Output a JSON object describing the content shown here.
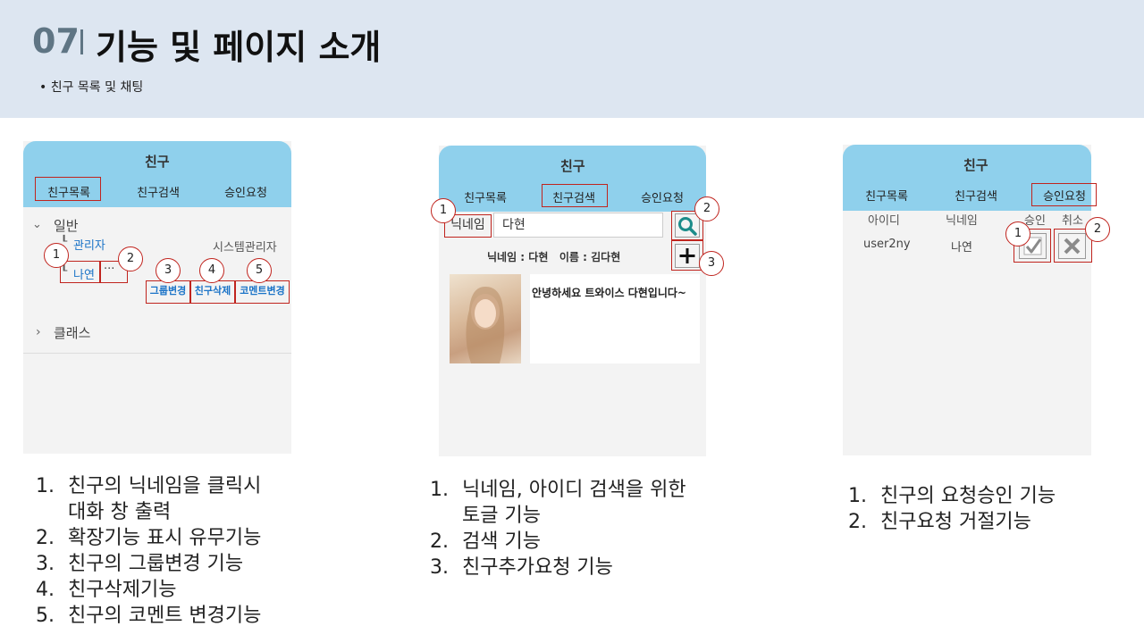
{
  "header": {
    "number": "07",
    "title": "기능 및 페이지 소개",
    "subtitle": "• 친구 목록 및 채팅"
  },
  "panel1": {
    "title": "친구",
    "tabs": [
      "친구목록",
      "친구검색",
      "승인요청"
    ],
    "group_general": "일반",
    "friend1": "관리자",
    "friend1_comment": "시스템관리자",
    "friend2": "나연",
    "more": "···",
    "btn_group": "그룹변경",
    "btn_delete": "친구삭제",
    "btn_comment": "코멘트변경",
    "group_class": "클래스",
    "markers": [
      "1",
      "2",
      "3",
      "4",
      "5"
    ]
  },
  "panel2": {
    "title": "친구",
    "tabs": [
      "친구목록",
      "친구검색",
      "승인요청"
    ],
    "search_type": "닉네임",
    "search_value": "다현",
    "result": "닉네임 : 다현   이름 : 김다현",
    "profile_text": "안녕하세요 트와이스 다현입니다~",
    "markers": [
      "1",
      "2",
      "3"
    ]
  },
  "panel3": {
    "title": "친구",
    "tabs": [
      "친구목록",
      "친구검색",
      "승인요청"
    ],
    "columns": [
      "아이디",
      "닉네임",
      "승인",
      "취소"
    ],
    "row": {
      "id": "user2ny",
      "nickname": "나연"
    },
    "markers": [
      "1",
      "2"
    ]
  },
  "descriptions": {
    "col1": [
      {
        "n": "1.",
        "t": "친구의 닉네임을 클릭시"
      },
      {
        "n": "",
        "t": "대화 창 출력"
      },
      {
        "n": "2.",
        "t": "확장기능 표시 유무기능"
      },
      {
        "n": "3.",
        "t": "친구의 그룹변경 기능"
      },
      {
        "n": "4.",
        "t": "친구삭제기능"
      },
      {
        "n": "5.",
        "t": "친구의 코멘트 변경기능"
      }
    ],
    "col2": [
      {
        "n": "1.",
        "t": "닉네임, 아이디 검색을 위한"
      },
      {
        "n": "",
        "t": "토글 기능"
      },
      {
        "n": "2.",
        "t": "검색 기능"
      },
      {
        "n": "3.",
        "t": "친구추가요청 기능"
      }
    ],
    "col3": [
      {
        "n": "1.",
        "t": "친구의 요청승인 기능"
      },
      {
        "n": "2.",
        "t": "친구요청 거절기능"
      }
    ]
  }
}
